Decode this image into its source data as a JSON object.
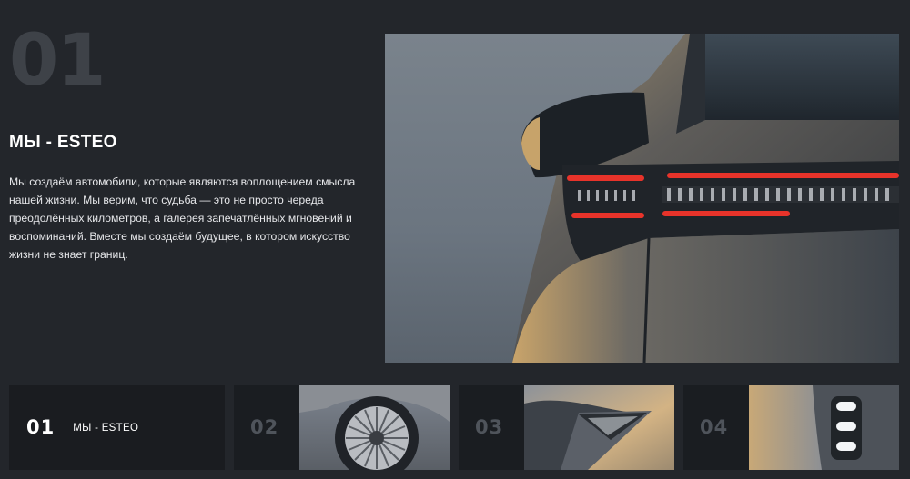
{
  "hero": {
    "number": "01",
    "title": "МЫ - ESTEO",
    "description": "Мы создаём автомобили, которые являются воплощением смысла нашей жизни. Мы верим, что судьба — это не просто череда преодолённых километров, а галерея запечатлённых мгновений и воспоминаний. Вместе мы создаём будущее, в котором искусство жизни не знает границ."
  },
  "tabs": [
    {
      "number": "01",
      "label": "МЫ - ESTEO",
      "active": true
    },
    {
      "number": "02",
      "active": false,
      "thumbnail": "car-wheel"
    },
    {
      "number": "03",
      "active": false,
      "thumbnail": "car-rear-side"
    },
    {
      "number": "04",
      "active": false,
      "thumbnail": "car-front-lights"
    }
  ],
  "colors": {
    "background": "#23262b",
    "panel": "#1a1d21",
    "muted_number": "#3e4248",
    "tail_light": "#e8332a"
  }
}
